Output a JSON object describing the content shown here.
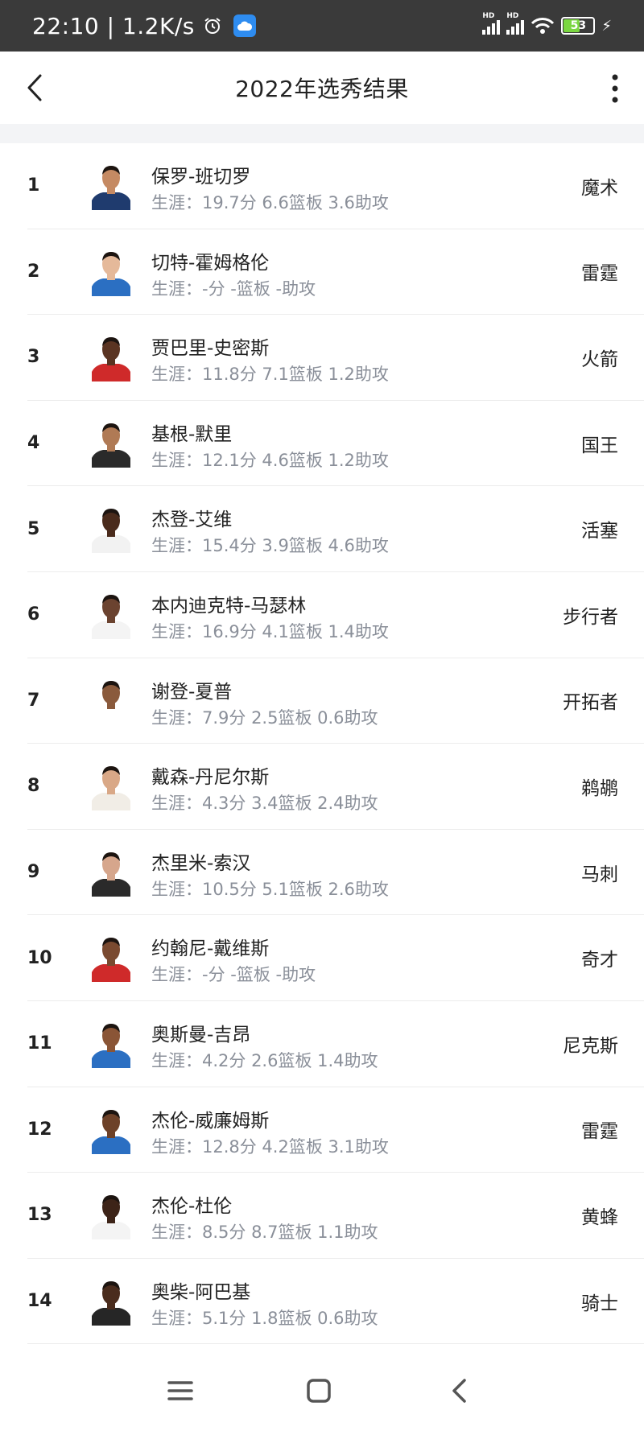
{
  "status_bar": {
    "time": "22:10 | 1.2K/s",
    "battery": "53"
  },
  "header": {
    "title": "2022年选秀结果"
  },
  "players": [
    {
      "rank": "1",
      "name": "保罗-班切罗",
      "stats": "生涯：19.7分 6.6篮板 3.6助攻",
      "team": "魔术",
      "skin": "#c58a63",
      "jersey": "#1f3b6e"
    },
    {
      "rank": "2",
      "name": "切特-霍姆格伦",
      "stats": "生涯：-分 -篮板 -助攻",
      "team": "雷霆",
      "skin": "#e5b99a",
      "jersey": "#2b6fc2"
    },
    {
      "rank": "3",
      "name": "贾巴里-史密斯",
      "stats": "生涯：11.8分 7.1篮板 1.2助攻",
      "team": "火箭",
      "skin": "#5a3422",
      "jersey": "#cf2a2a"
    },
    {
      "rank": "4",
      "name": "基根-默里",
      "stats": "生涯：12.1分 4.6篮板 1.2助攻",
      "team": "国王",
      "skin": "#b07a55",
      "jersey": "#2a2a2a"
    },
    {
      "rank": "5",
      "name": "杰登-艾维",
      "stats": "生涯：15.4分 3.9篮板 4.6助攻",
      "team": "活塞",
      "skin": "#4a2b1c",
      "jersey": "#f2f2f2"
    },
    {
      "rank": "6",
      "name": "本内迪克特-马瑟林",
      "stats": "生涯：16.9分 4.1篮板 1.4助攻",
      "team": "步行者",
      "skin": "#6b4330",
      "jersey": "#f4f4f4"
    },
    {
      "rank": "7",
      "name": "谢登-夏普",
      "stats": "生涯：7.9分 2.5篮板 0.6助攻",
      "team": "开拓者",
      "skin": "#8a5a3c",
      "jersey": "#ffffff"
    },
    {
      "rank": "8",
      "name": "戴森-丹尼尔斯",
      "stats": "生涯：4.3分 3.4篮板 2.4助攻",
      "team": "鹈鹕",
      "skin": "#d9a887",
      "jersey": "#f1ede6"
    },
    {
      "rank": "9",
      "name": "杰里米-索汉",
      "stats": "生涯：10.5分 5.1篮板 2.6助攻",
      "team": "马刺",
      "skin": "#d6a68c",
      "jersey": "#2a2a2a"
    },
    {
      "rank": "10",
      "name": "约翰尼-戴维斯",
      "stats": "生涯：-分 -篮板 -助攻",
      "team": "奇才",
      "skin": "#7a4a30",
      "jersey": "#cf2a2a"
    },
    {
      "rank": "11",
      "name": "奥斯曼-吉昂",
      "stats": "生涯：4.2分 2.6篮板 1.4助攻",
      "team": "尼克斯",
      "skin": "#8a5536",
      "jersey": "#2b6fc2"
    },
    {
      "rank": "12",
      "name": "杰伦-威廉姆斯",
      "stats": "生涯：12.8分 4.2篮板 3.1助攻",
      "team": "雷霆",
      "skin": "#6d4128",
      "jersey": "#2b6fc2"
    },
    {
      "rank": "13",
      "name": "杰伦-杜伦",
      "stats": "生涯：8.5分 8.7篮板 1.1助攻",
      "team": "黄蜂",
      "skin": "#3d2418",
      "jersey": "#f4f4f4"
    },
    {
      "rank": "14",
      "name": "奥柴-阿巴基",
      "stats": "生涯：5.1分 1.8篮板 0.6助攻",
      "team": "骑士",
      "skin": "#4a2c1d",
      "jersey": "#262626"
    }
  ]
}
